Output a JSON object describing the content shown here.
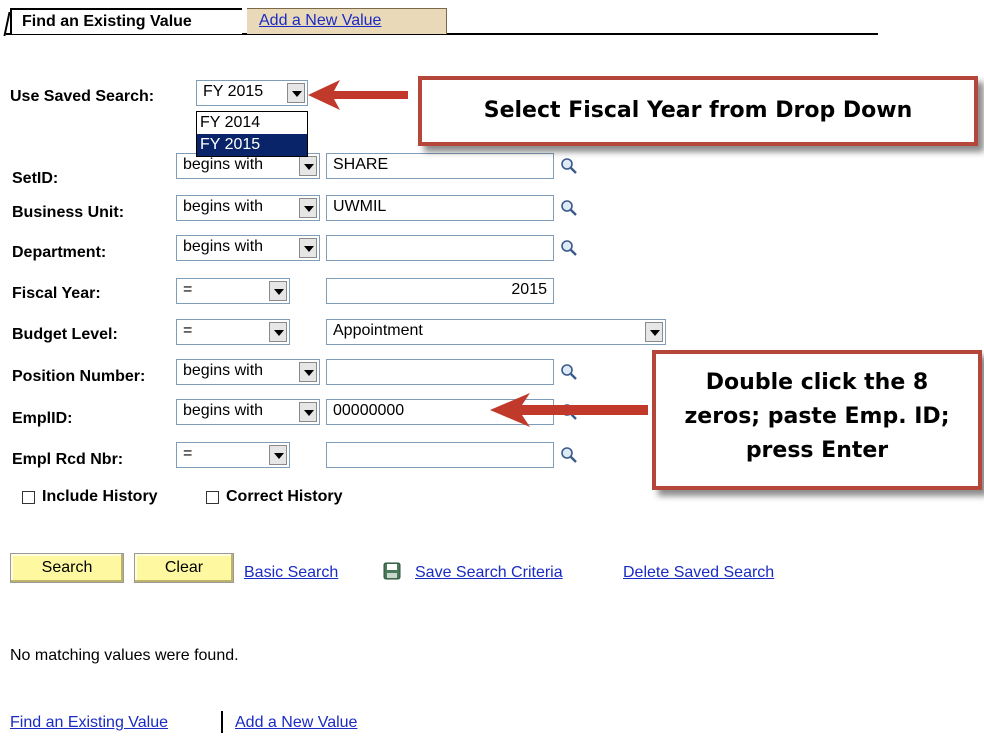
{
  "tabs": {
    "find": "Find an Existing Value",
    "add": "Add a New Value"
  },
  "saved_search": {
    "label": "Use Saved Search:",
    "value": "FY 2015",
    "options": [
      "FY 2014",
      "FY 2015"
    ]
  },
  "fields": {
    "setid": {
      "label": "SetID:",
      "op": "begins with",
      "value": "SHARE"
    },
    "business_unit": {
      "label": "Business Unit:",
      "op": "begins with",
      "value": "UWMIL"
    },
    "department": {
      "label": "Department:",
      "op": "begins with",
      "value": ""
    },
    "fiscal_year": {
      "label": "Fiscal Year:",
      "op": "=",
      "value": "2015"
    },
    "budget_level": {
      "label": "Budget Level:",
      "op": "=",
      "value": "Appointment"
    },
    "position_number": {
      "label": "Position Number:",
      "op": "begins with",
      "value": ""
    },
    "emplid": {
      "label": "EmplID:",
      "op": "begins with",
      "value": "00000000"
    },
    "empl_rcd": {
      "label": "Empl Rcd Nbr:",
      "op": "=",
      "value": ""
    }
  },
  "checkboxes": {
    "include_history": "Include History",
    "correct_history": "Correct History"
  },
  "buttons": {
    "search": "Search",
    "clear": "Clear"
  },
  "links": {
    "basic_search": "Basic Search",
    "save_criteria": "Save Search Criteria",
    "delete_saved": "Delete Saved Search"
  },
  "message": "No matching values were found.",
  "footer": {
    "find": "Find an Existing Value",
    "add": "Add a New Value"
  },
  "callouts": {
    "top": "Select Fiscal Year from Drop Down",
    "bottom_line1": "Double click the 8",
    "bottom_line2": "zeros; paste Emp. ID;",
    "bottom_line3": "press Enter"
  },
  "colors": {
    "link": "#1a2bc4",
    "button_bg": "#fef9a0",
    "callout_border": "#b5473a",
    "arrow": "#c0392b"
  }
}
